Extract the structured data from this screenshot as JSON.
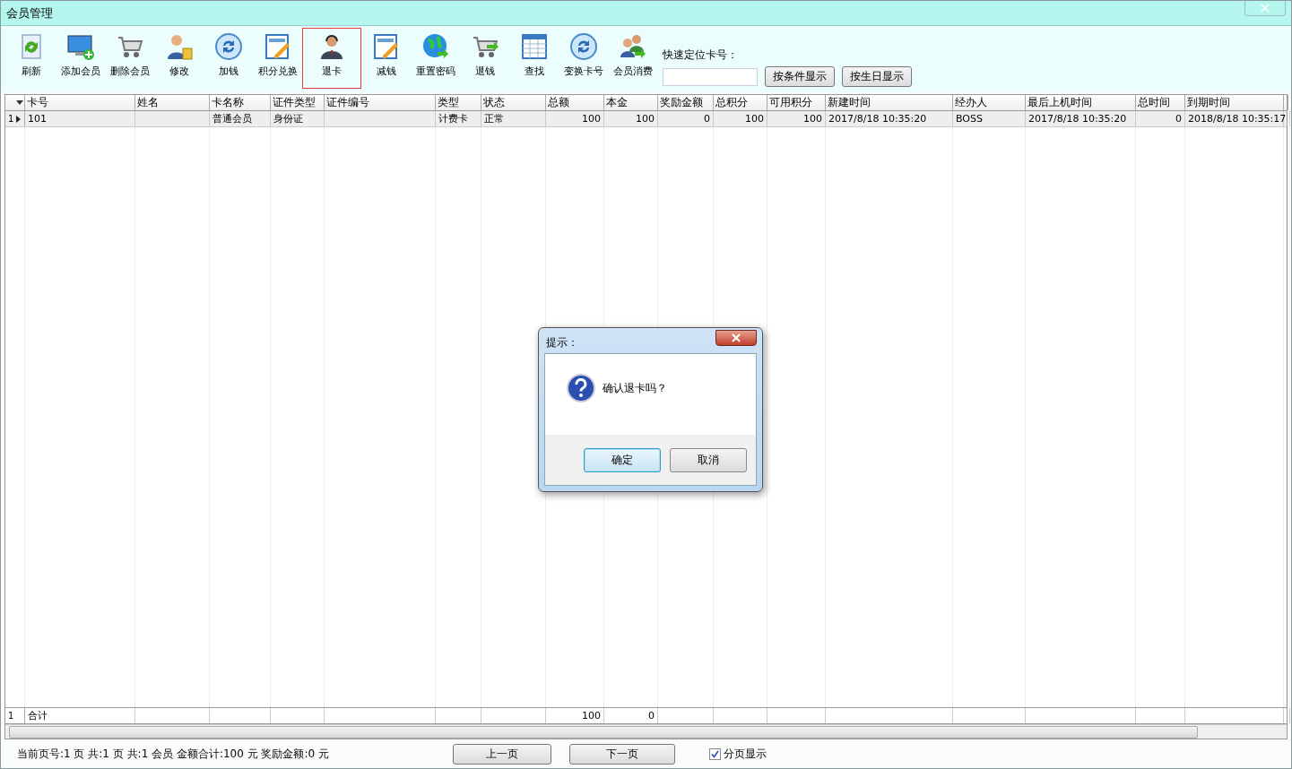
{
  "window": {
    "title": "会员管理"
  },
  "toolbar": [
    {
      "label": "刷新",
      "selected": false
    },
    {
      "label": "添加会员",
      "selected": false
    },
    {
      "label": "删除会员",
      "selected": false
    },
    {
      "label": "修改",
      "selected": false
    },
    {
      "label": "加钱",
      "selected": false
    },
    {
      "label": "积分兑换",
      "selected": false
    },
    {
      "label": "退卡",
      "selected": true
    },
    {
      "label": "减钱",
      "selected": false
    },
    {
      "label": "重置密码",
      "selected": false
    },
    {
      "label": "退钱",
      "selected": false
    },
    {
      "label": "查找",
      "selected": false
    },
    {
      "label": "变换卡号",
      "selected": false
    },
    {
      "label": "会员消费",
      "selected": false
    }
  ],
  "quick_locate": {
    "label": "快速定位卡号：",
    "buttons": [
      "按条件显示",
      "按生日显示"
    ]
  },
  "table": {
    "columns": [
      {
        "label": "卡号",
        "kind": "text"
      },
      {
        "label": "姓名",
        "kind": "text"
      },
      {
        "label": "卡名称",
        "kind": "text"
      },
      {
        "label": "证件类型",
        "kind": "text"
      },
      {
        "label": "证件编号",
        "kind": "text"
      },
      {
        "label": "类型",
        "kind": "text"
      },
      {
        "label": "状态",
        "kind": "text"
      },
      {
        "label": "总额",
        "kind": "number"
      },
      {
        "label": "本金",
        "kind": "number"
      },
      {
        "label": "奖励金额",
        "kind": "number"
      },
      {
        "label": "总积分",
        "kind": "number"
      },
      {
        "label": "可用积分",
        "kind": "number"
      },
      {
        "label": "新建时间",
        "kind": "text"
      },
      {
        "label": "经办人",
        "kind": "text"
      },
      {
        "label": "最后上机时间",
        "kind": "text"
      },
      {
        "label": "总时间",
        "kind": "number"
      },
      {
        "label": "到期时间",
        "kind": "text"
      }
    ],
    "rows": [
      {
        "number": "1",
        "current": true,
        "cells": [
          "101",
          "",
          "普通会员",
          "身份证",
          "",
          "计费卡",
          "正常",
          "100",
          "100",
          "0",
          "100",
          "100",
          "2017/8/18 10:35:20",
          "BOSS",
          "2017/8/18 10:35:20",
          "0",
          "2018/8/18 10:35:17"
        ]
      }
    ],
    "totals": {
      "number": "1",
      "cells": [
        "合计",
        "",
        "",
        "",
        "",
        "",
        "",
        "100",
        "0",
        "",
        "",
        "",
        "",
        "",
        "",
        "",
        ""
      ]
    }
  },
  "status": {
    "text": "当前页号:1 页 共:1 页 共:1 会员 金额合计:100 元 奖励金额:0 元",
    "prev": "上一页",
    "next": "下一页",
    "paging": {
      "label": "分页显示",
      "checked": true
    }
  },
  "dialog": {
    "title": "提示：",
    "message": "确认退卡吗？",
    "buttons": [
      {
        "label": "确定",
        "selected": true
      },
      {
        "label": "取消",
        "selected": false
      }
    ]
  }
}
